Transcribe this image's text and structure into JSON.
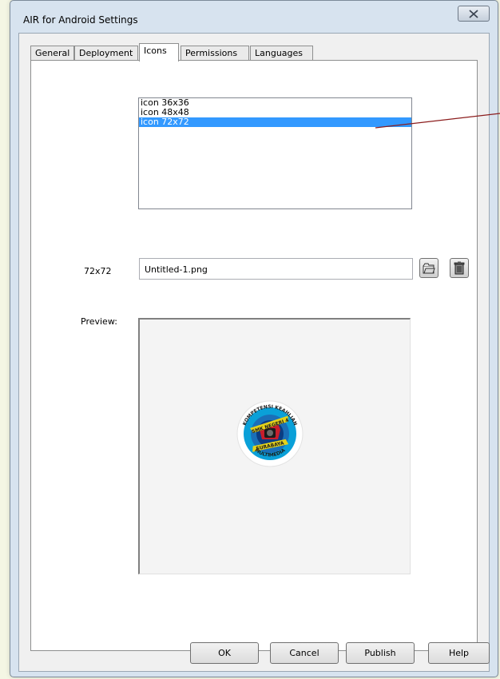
{
  "window": {
    "title": "AIR for Android Settings"
  },
  "tabs": [
    {
      "label": "General"
    },
    {
      "label": "Deployment"
    },
    {
      "label": "Icons"
    },
    {
      "label": "Permissions"
    },
    {
      "label": "Languages"
    }
  ],
  "active_tab": "Icons",
  "icon_list": {
    "items": [
      "icon 36x36",
      "icon 48x48",
      "icon 72x72"
    ],
    "selected": "icon 72x72"
  },
  "icon_field": {
    "label": "72x72",
    "value": "Untitled-1.png"
  },
  "preview": {
    "label": "Preview:",
    "logo_text": {
      "top_arc": "KOMPETENSI KEAHLIAN",
      "banner_top": "SMK NEGERI 4",
      "banner_bottom": "SURABAYA",
      "bottom_arc": "MULTIMEDIA"
    }
  },
  "buttons": {
    "ok": "OK",
    "cancel": "Cancel",
    "publish": "Publish",
    "help": "Help"
  },
  "icons": {
    "close": "close-icon",
    "browse": "folder-icon",
    "delete": "trash-icon"
  },
  "colors": {
    "selection": "#3399ff",
    "callout_line": "#8b1c1c",
    "logo_ring": "#0aa0d8",
    "logo_banner": "#e4d21a"
  }
}
